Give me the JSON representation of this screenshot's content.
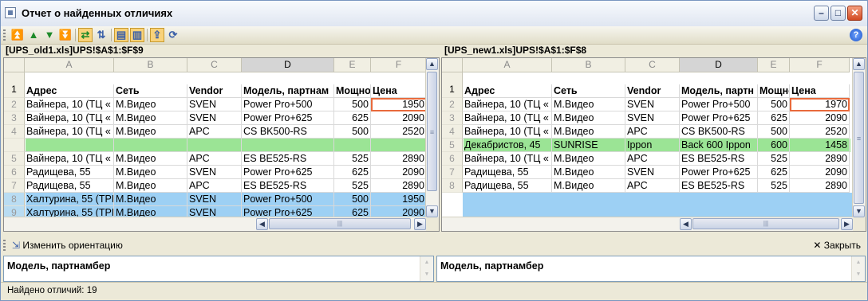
{
  "window": {
    "title": "Отчет о найденных отличиях"
  },
  "toolbar": {
    "help_label": "?"
  },
  "colors": {
    "added_row": "#9be495",
    "missing_row": "#9be495",
    "selected_row": "#9dd0f4",
    "diff_border": "#e86a3c"
  },
  "left_pane": {
    "title": "[UPS_old1.xls]UPS!$A$1:$F$9",
    "columns": [
      "A",
      "B",
      "C",
      "D",
      "E",
      "F"
    ],
    "header_row": [
      "Адрес",
      "Сеть",
      "Vendor",
      "Модель, партнам",
      "Мощно",
      "Цена"
    ],
    "rows": [
      {
        "num": "2",
        "cells": [
          "Вайнера, 10 (ТЦ «",
          "М.Видео",
          "SVEN",
          "Power Pro+500",
          "500",
          "1950"
        ],
        "hl": 5
      },
      {
        "num": "3",
        "cells": [
          "Вайнера, 10 (ТЦ «",
          "М.Видео",
          "SVEN",
          "Power Pro+625",
          "625",
          "2090"
        ]
      },
      {
        "num": "4",
        "cells": [
          "Вайнера, 10 (ТЦ «",
          "М.Видео",
          "APC",
          "CS BK500-RS",
          "500",
          "2520"
        ]
      },
      {
        "num": "",
        "cells": [
          "",
          "",
          "",
          "",
          "",
          ""
        ],
        "band": "green"
      },
      {
        "num": "5",
        "cells": [
          "Вайнера, 10 (ТЦ «",
          "М.Видео",
          "APC",
          "ES BE525-RS",
          "525",
          "2890"
        ]
      },
      {
        "num": "6",
        "cells": [
          "Радищева, 55",
          "М.Видео",
          "SVEN",
          "Power Pro+625",
          "625",
          "2090"
        ]
      },
      {
        "num": "7",
        "cells": [
          "Радищева, 55",
          "М.Видео",
          "APC",
          "ES BE525-RS",
          "525",
          "2890"
        ]
      },
      {
        "num": "8",
        "cells": [
          "Халтурина, 55 (ТРІ",
          "М.Видео",
          "SVEN",
          "Power Pro+500",
          "500",
          "1950"
        ],
        "band": "blue"
      },
      {
        "num": "9",
        "cells": [
          "Халтурина, 55 (ТРІ",
          "М.Видео",
          "SVEN",
          "Power Pro+625",
          "625",
          "2090"
        ],
        "band": "blue"
      }
    ]
  },
  "right_pane": {
    "title": "[UPS_new1.xls]UPS!$A$1:$F$8",
    "columns": [
      "A",
      "B",
      "C",
      "D",
      "E",
      "F"
    ],
    "header_row": [
      "Адрес",
      "Сеть",
      "Vendor",
      "Модель, партн",
      "Мощно",
      "Цена"
    ],
    "rows": [
      {
        "num": "2",
        "cells": [
          "Вайнера, 10 (ТЦ «",
          "М.Видео",
          "SVEN",
          "Power Pro+500",
          "500",
          "1970"
        ],
        "hl": 5
      },
      {
        "num": "3",
        "cells": [
          "Вайнера, 10 (ТЦ «",
          "М.Видео",
          "SVEN",
          "Power Pro+625",
          "625",
          "2090"
        ]
      },
      {
        "num": "4",
        "cells": [
          "Вайнера, 10 (ТЦ «",
          "М.Видео",
          "APC",
          "CS BK500-RS",
          "500",
          "2520"
        ]
      },
      {
        "num": "5",
        "cells": [
          "Декабристов, 45",
          "SUNRISE",
          "Ippon",
          "Back 600 Ippon",
          "600",
          "1458"
        ],
        "band": "green"
      },
      {
        "num": "6",
        "cells": [
          "Вайнера, 10 (ТЦ «",
          "М.Видео",
          "APC",
          "ES BE525-RS",
          "525",
          "2890"
        ]
      },
      {
        "num": "7",
        "cells": [
          "Радищева, 55",
          "М.Видео",
          "SVEN",
          "Power Pro+625",
          "625",
          "2090"
        ]
      },
      {
        "num": "8",
        "cells": [
          "Радищева, 55",
          "М.Видео",
          "APC",
          "ES BE525-RS",
          "525",
          "2890"
        ]
      }
    ]
  },
  "orientation_button": "Изменить ориентацию",
  "close_button": "Закрыть",
  "memo_left": "Модель, партнамбер",
  "memo_right": "Модель, партнамбер",
  "status": "Найдено отличий:  19"
}
